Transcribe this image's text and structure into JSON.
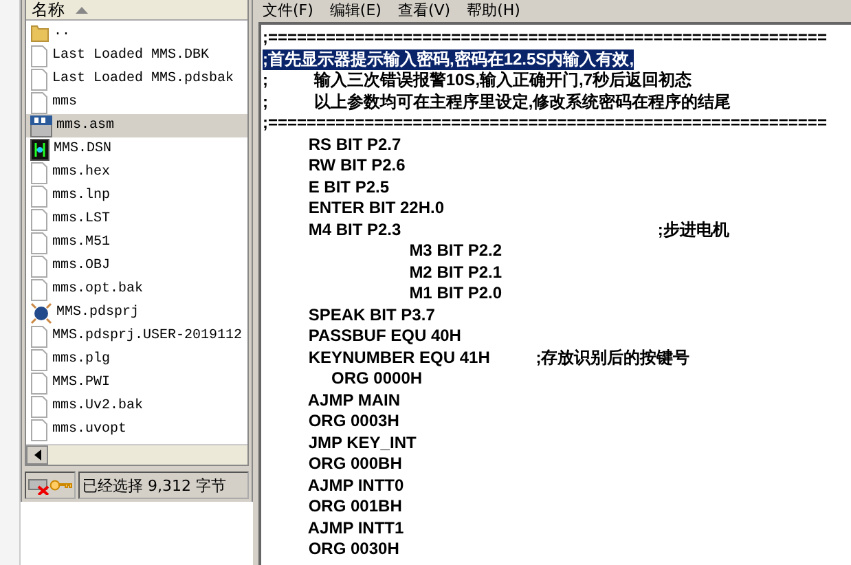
{
  "file_list": {
    "header": "名称",
    "items": [
      {
        "name": "..",
        "kind": "folder",
        "selected": false
      },
      {
        "name": "Last Loaded MMS.DBK",
        "kind": "file",
        "selected": false
      },
      {
        "name": "Last Loaded MMS.pdsbak",
        "kind": "file",
        "selected": false
      },
      {
        "name": "mms",
        "kind": "file",
        "selected": false
      },
      {
        "name": "mms.asm",
        "kind": "asm",
        "selected": true
      },
      {
        "name": "MMS.DSN",
        "kind": "dsn",
        "selected": false
      },
      {
        "name": "mms.hex",
        "kind": "file",
        "selected": false
      },
      {
        "name": "mms.lnp",
        "kind": "file",
        "selected": false
      },
      {
        "name": "mms.LST",
        "kind": "file",
        "selected": false
      },
      {
        "name": "mms.M51",
        "kind": "file",
        "selected": false
      },
      {
        "name": "mms.OBJ",
        "kind": "file",
        "selected": false
      },
      {
        "name": "mms.opt.bak",
        "kind": "file",
        "selected": false
      },
      {
        "name": "MMS.pdsprj",
        "kind": "project",
        "selected": false
      },
      {
        "name": "MMS.pdsprj.USER-2019112",
        "kind": "file",
        "selected": false
      },
      {
        "name": "mms.plg",
        "kind": "file",
        "selected": false
      },
      {
        "name": "MMS.PWI",
        "kind": "file",
        "selected": false
      },
      {
        "name": "mms.Uv2.bak",
        "kind": "file",
        "selected": false
      },
      {
        "name": "mms.uvopt",
        "kind": "file",
        "selected": false
      }
    ],
    "status": "已经选择 9,312 字节"
  },
  "editor": {
    "menu": [
      "文件(F)",
      "编辑(E)",
      "查看(V)",
      "帮助(H)"
    ],
    "lines": [
      {
        "text": ";==========================================================",
        "selected": false
      },
      {
        "text": ";首先显示器提示输入密码,密码在12.5S内输入有效,",
        "selected": true
      },
      {
        "text": ";          输入三次错误报警10S,输入正确开门,7秒后返回初态",
        "selected": false
      },
      {
        "text": ";          以上参数均可在主程序里设定,修改系统密码在程序的结尾",
        "selected": false
      },
      {
        "text": ";==========================================================",
        "selected": false
      },
      {
        "text": "          RS BIT P2.7",
        "selected": false
      },
      {
        "text": "          RW BIT P2.6",
        "selected": false
      },
      {
        "text": "          E BIT P2.5",
        "selected": false
      },
      {
        "text": "          ENTER BIT 22H.0",
        "selected": false
      },
      {
        "text": "          M4 BIT P2.3                                                        ;步进电机",
        "selected": false
      },
      {
        "text": "                                M3 BIT P2.2",
        "selected": false
      },
      {
        "text": "                                M2 BIT P2.1",
        "selected": false
      },
      {
        "text": "                                M1 BIT P2.0",
        "selected": false
      },
      {
        "text": "          SPEAK BIT P3.7",
        "selected": false
      },
      {
        "text": "          PASSBUF EQU 40H",
        "selected": false
      },
      {
        "text": "          KEYNUMBER EQU 41H          ;存放识别后的按键号",
        "selected": false
      },
      {
        "text": "               ORG 0000H",
        "selected": false
      },
      {
        "text": "          AJMP MAIN",
        "selected": false
      },
      {
        "text": "          ORG 0003H",
        "selected": false
      },
      {
        "text": "          JMP KEY_INT",
        "selected": false
      },
      {
        "text": "          ORG 000BH",
        "selected": false
      },
      {
        "text": "          AJMP INTT0",
        "selected": false
      },
      {
        "text": "          ORG 001BH",
        "selected": false
      },
      {
        "text": "          AJMP INTT1",
        "selected": false
      },
      {
        "text": "          ORG 0030H",
        "selected": false
      }
    ]
  }
}
